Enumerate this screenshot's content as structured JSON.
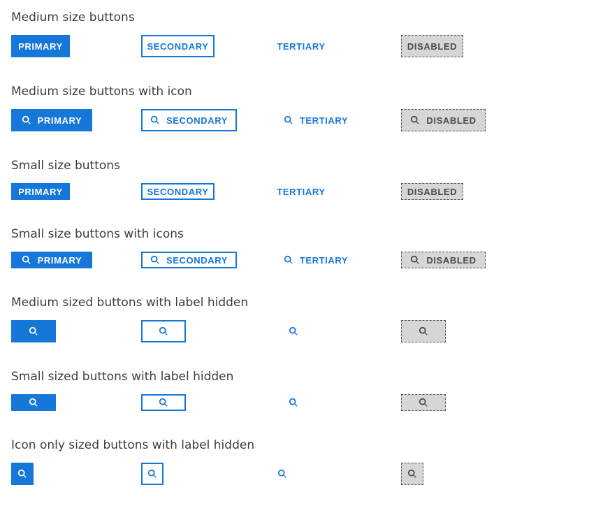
{
  "sections": {
    "medium": "Medium size buttons",
    "medium_icon": "Medium size buttons with icon",
    "small": "Small size buttons",
    "small_icon": "Small size buttons with icons",
    "medium_hidden": "Medium sized buttons with label hidden",
    "small_hidden": "Small sized buttons with label hidden",
    "icon_only": "Icon only sized buttons with label hidden"
  },
  "labels": {
    "primary": "PRIMARY",
    "secondary": "SECONDARY",
    "tertiary": "TERTIARY",
    "disabled": "DISABLED"
  },
  "icon": "search-icon",
  "colors": {
    "accent": "#1577d8",
    "disabled_bg": "#d6d6d6",
    "text": "#3d3d3d"
  }
}
